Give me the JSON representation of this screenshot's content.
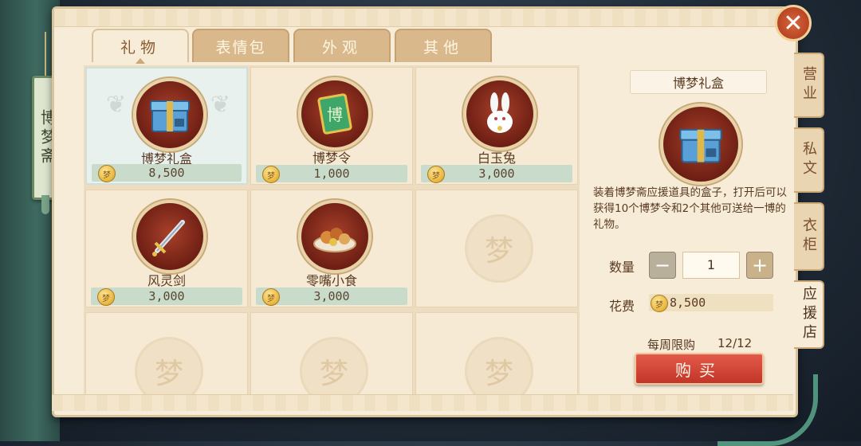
{
  "side_tag": "博梦斋",
  "tabs": [
    {
      "label": "礼物"
    },
    {
      "label": "表情包"
    },
    {
      "label": "外观"
    },
    {
      "label": "其他"
    }
  ],
  "items": [
    {
      "name": "博梦礼盒",
      "price": "8,500",
      "icon": "gift-box-icon",
      "selected": true
    },
    {
      "name": "博梦令",
      "price": "1,000",
      "icon": "token-book-icon"
    },
    {
      "name": "白玉兔",
      "price": "3,000",
      "icon": "rabbit-icon"
    },
    {
      "name": "风灵剑",
      "price": "3,000",
      "icon": "sword-icon"
    },
    {
      "name": "零嘴小食",
      "price": "3,000",
      "icon": "snack-plate-icon"
    }
  ],
  "empty_slot_glyph": "梦",
  "detail": {
    "title": "博梦礼盒",
    "description": "装着博梦斋应援道具的盒子，打开后可以获得10个博梦令和2个其他可送给一博的礼物。",
    "quantity_label": "数量",
    "quantity_value": "1",
    "minus": "−",
    "plus": "+",
    "cost_label": "花费",
    "cost_value": "8,500",
    "weekly_limit_label": "每周限购",
    "weekly_limit_value": "12/12",
    "buy_label": "购买"
  },
  "side_tabs": [
    {
      "label": "营业"
    },
    {
      "label": "私文"
    },
    {
      "label": "衣柜"
    },
    {
      "label": "应援店"
    }
  ],
  "close_glyph": "✕",
  "coin_glyph": "梦"
}
